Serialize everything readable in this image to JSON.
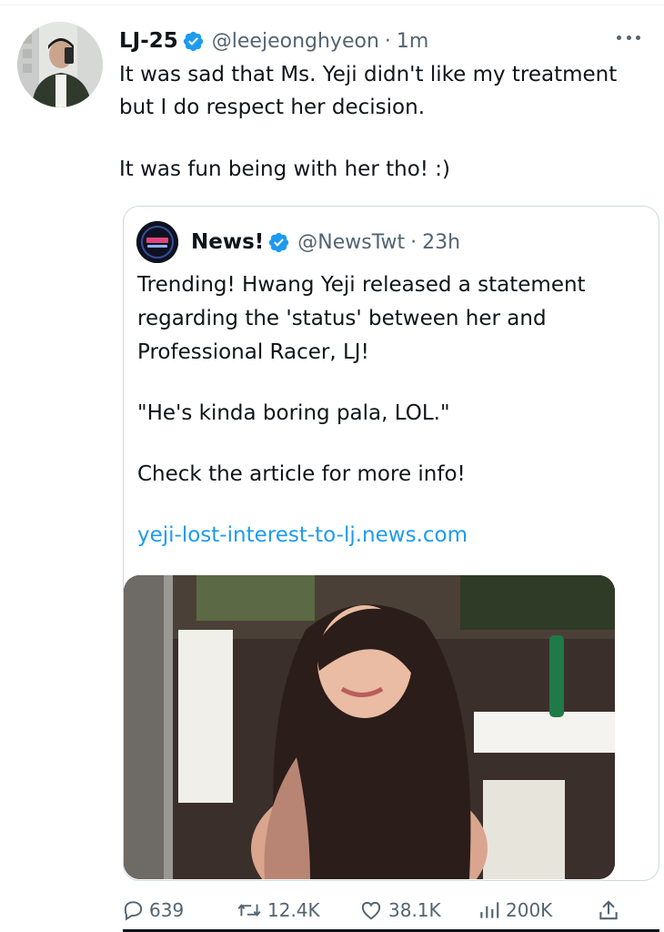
{
  "tweet": {
    "display_name": "LJ-25",
    "handle": "@leejeonghyeon",
    "separator": "·",
    "time": "1m",
    "text_line1": "It was sad that Ms. Yeji didn't like my treatment",
    "text_line2": "but I do respect her decision.",
    "text_line3": "It was fun being with her tho! :)",
    "avatar_icon": "profile-photo",
    "more_icon": "more-dots-icon"
  },
  "quote": {
    "display_name": "News!",
    "handle": "@NewsTwt",
    "separator": "·",
    "time": "23h",
    "line1": "Trending! Hwang Yeji released a statement",
    "line2": "regarding the 'status' between her and",
    "line3": "Professional Racer, LJ!",
    "line4": "\"He's kinda boring pala, LOL.\"",
    "line5": "Check the article for more info!",
    "link": "yeji-lost-interest-to-lj.news.com",
    "avatar_icon": "news-logo",
    "media_icon": "photo"
  },
  "actions": {
    "replies": "639",
    "retweets": "12.4K",
    "likes": "38.1K",
    "views": "200K"
  },
  "colors": {
    "text": "#0f1419",
    "secondary": "#536471",
    "link": "#1d9bf0",
    "verified": "#1d9bf0",
    "border": "#cfd9de"
  }
}
